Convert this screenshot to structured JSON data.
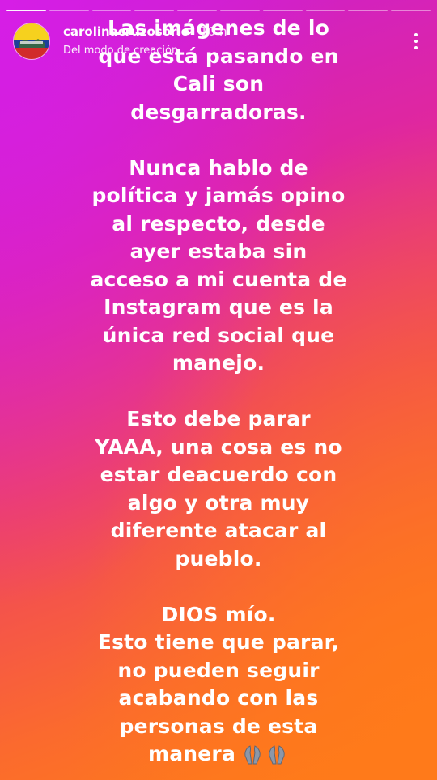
{
  "story": {
    "progress_segments": 10,
    "progress_completed": 1,
    "header": {
      "username": "carolinacruzosorio",
      "time": "10 h",
      "subtitle": "Del modo de creación",
      "more_icon": "more-vertical-icon",
      "avatar_icon": "colombia-flag-avatar"
    },
    "paragraphs": [
      {
        "lines": [
          "Las imágenes de lo",
          "que está pasando en",
          "Cali son",
          "desgarradoras."
        ]
      },
      {
        "lines": [
          "Nunca hablo de",
          "política y jamás opino",
          "al respecto, desde",
          "ayer estaba sin",
          "acceso a mi cuenta de",
          "Instagram que es la",
          "única red social que",
          "manejo."
        ]
      },
      {
        "lines": [
          "Esto debe parar",
          "YAAA,  una cosa es no",
          "estar deacuerdo con",
          "algo y otra muy",
          "diferente atacar al",
          "pueblo."
        ]
      },
      {
        "lines": [
          "DIOS mío.",
          "Esto tiene que parar,",
          "no pueden seguir",
          "acabando con las",
          "personas de esta",
          "manera"
        ]
      }
    ],
    "emoji": "🙏🙏",
    "emoji_icon": "folded-hands-icon",
    "colors": {
      "gradient_top": "#d61ee6",
      "gradient_bottom": "#ff7f14",
      "text": "#ffffff"
    }
  }
}
